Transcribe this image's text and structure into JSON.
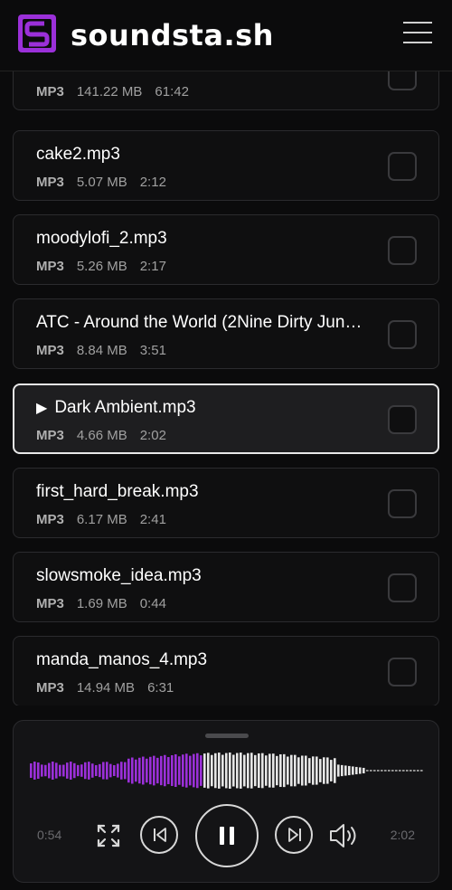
{
  "app": {
    "brand": "soundsta.sh"
  },
  "colors": {
    "accent": "#9b30d9",
    "played_wave": "#9b30d9",
    "unplayed_wave": "#e6e6e6"
  },
  "files": [
    {
      "name": "",
      "format": "MP3",
      "size": "141.22 MB",
      "duration": "61:42"
    },
    {
      "name": "cake2.mp3",
      "format": "MP3",
      "size": "5.07 MB",
      "duration": "2:12"
    },
    {
      "name": "moodylofi_2.mp3",
      "format": "MP3",
      "size": "5.26 MB",
      "duration": "2:17"
    },
    {
      "name": "ATC - Around the World (2Nine Dirty Jun…",
      "format": "MP3",
      "size": "8.84 MB",
      "duration": "3:51"
    },
    {
      "name": "Dark Ambient.mp3",
      "format": "MP3",
      "size": "4.66 MB",
      "duration": "2:02",
      "playing": true
    },
    {
      "name": "first_hard_break.mp3",
      "format": "MP3",
      "size": "6.17 MB",
      "duration": "2:41"
    },
    {
      "name": "slowsmoke_idea.mp3",
      "format": "MP3",
      "size": "1.69 MB",
      "duration": "0:44"
    },
    {
      "name": "manda_manos_4.mp3",
      "format": "MP3",
      "size": "14.94 MB",
      "duration": "6:31"
    }
  ],
  "player": {
    "current_time": "0:54",
    "total_time": "2:02",
    "progress": 0.44,
    "state": "playing",
    "icons": [
      "fullscreen-icon",
      "skip-back-icon",
      "pause-icon",
      "skip-forward-icon",
      "volume-icon"
    ]
  }
}
